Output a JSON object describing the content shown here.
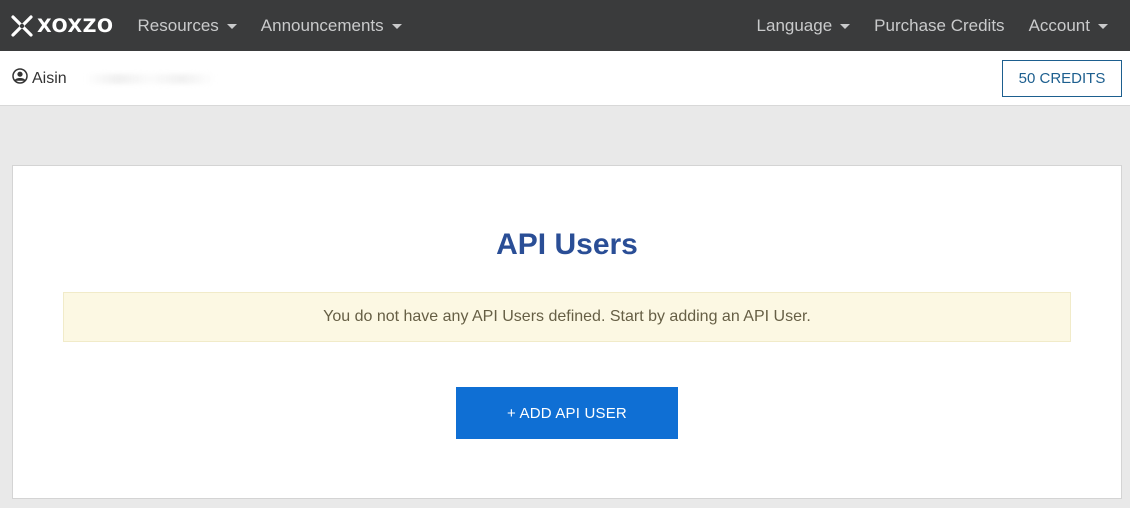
{
  "brand": {
    "name": "XOXZO",
    "logo_icon": "xoxzo-logo-icon"
  },
  "nav": {
    "left": [
      {
        "label": "Resources",
        "has_dropdown": true
      },
      {
        "label": "Announcements",
        "has_dropdown": true
      }
    ],
    "right": [
      {
        "label": "Language",
        "has_dropdown": true
      },
      {
        "label": "Purchase Credits",
        "has_dropdown": false
      },
      {
        "label": "Account",
        "has_dropdown": true
      }
    ]
  },
  "user": {
    "icon": "user-circle-icon",
    "name": "Aisin"
  },
  "credits": {
    "label": "50 CREDITS"
  },
  "main": {
    "title": "API Users",
    "alert": "You do not have any API Users defined. Start by adding an API User.",
    "add_button": "+ ADD API USER"
  },
  "colors": {
    "navbar_bg": "#3a3b3c",
    "title": "#2a4e96",
    "alert_bg": "#fcf8e3",
    "primary_button": "#0f6fd4",
    "credits_border": "#1d5f8f"
  }
}
